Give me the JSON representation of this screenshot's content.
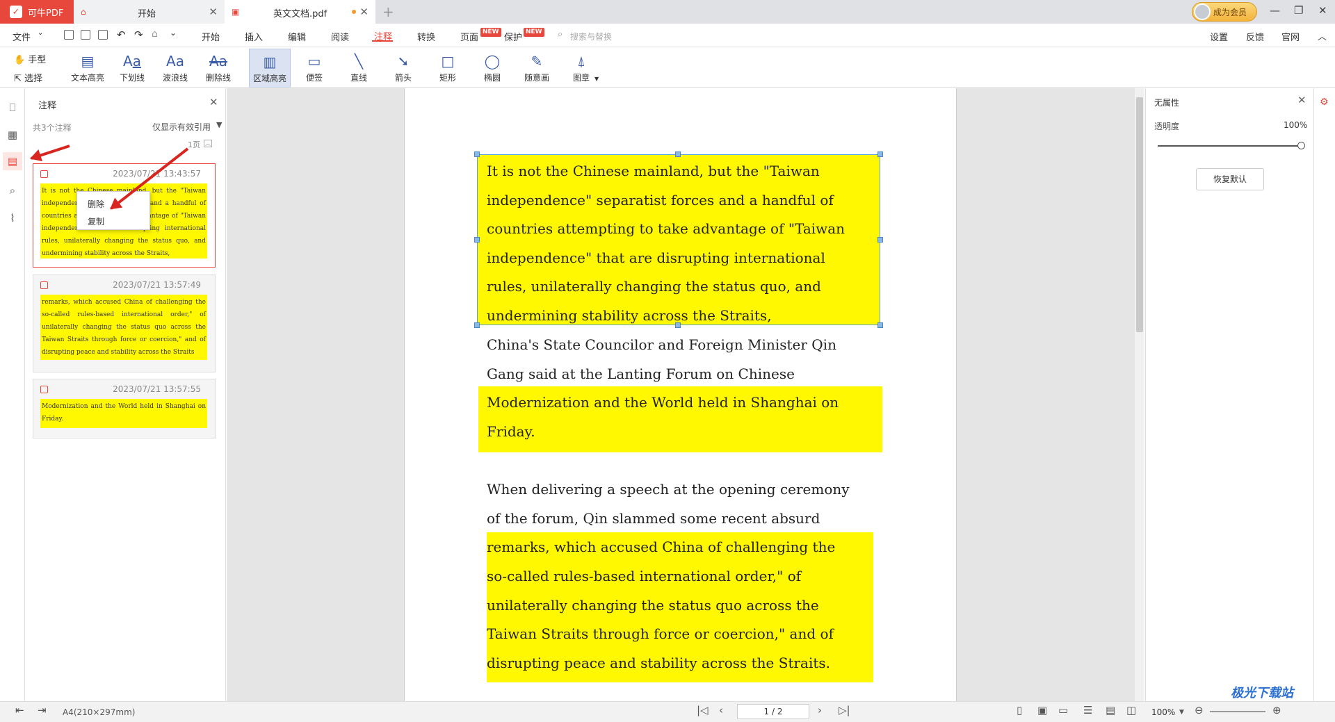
{
  "app": {
    "name": "可牛PDF"
  },
  "tabs": [
    {
      "label": "开始"
    },
    {
      "label": "英文文档.pdf"
    }
  ],
  "vip": {
    "label": "成为会员"
  },
  "menu": {
    "file": "文件",
    "items": [
      "开始",
      "插入",
      "编辑",
      "阅读",
      "注释",
      "转换",
      "页面",
      "保护"
    ],
    "active": "注释",
    "new_badge": "NEW",
    "search_placeholder": "搜索与替换",
    "right": [
      "设置",
      "反馈",
      "官网"
    ]
  },
  "toolbar": {
    "hand": "手型",
    "select": "选择",
    "tools": [
      "文本高亮",
      "下划线",
      "波浪线",
      "删除线",
      "区域高亮",
      "便签",
      "直线",
      "箭头",
      "矩形",
      "椭圆",
      "随意画",
      "图章"
    ],
    "selected": "区域高亮"
  },
  "annotations_panel": {
    "title": "注释",
    "count": "共3个注释",
    "filter_label": "仅显示有效引用",
    "page_group": "1页",
    "items": [
      {
        "time": "2023/07/21 13:43:57",
        "text": "It is not the Chinese mainland, but the \"Taiwan independence\" separatist forces and a handful of countries attempting to take advantage of \"Taiwan independence\" that are disrupting international rules, unilaterally changing the status quo, and undermining stability across the Straits,"
      },
      {
        "time": "2023/07/21 13:57:49",
        "text": "remarks, which accused China of challenging the so-called rules-based international order,\" of unilaterally changing the status quo across the Taiwan Straits through force or coercion,\" and of disrupting peace and stability across the Straits"
      },
      {
        "time": "2023/07/21 13:57:55",
        "text": "Modernization and the World held in Shanghai on Friday."
      }
    ],
    "context_menu": [
      "删除",
      "复制"
    ]
  },
  "document": {
    "lines": [
      "It is not the Chinese mainland, but the \"Taiwan",
      "independence\" separatist forces and a handful of",
      "countries attempting to take advantage of \"Taiwan",
      "independence\" that are disrupting international",
      "rules, unilaterally changing the status quo, and",
      "undermining  stability  across  the  Straits,",
      "China's State Councilor and Foreign Minister Qin",
      "Gang  said  at  the  Lanting  Forum  on  Chinese",
      "Modernization and the World held in Shanghai on",
      "Friday.",
      "When delivering a speech at the opening ceremony",
      "of  the  forum,  Qin  slammed  some  recent  absurd",
      "remarks, which accused China of challenging the",
      "so-called rules-based international order,\" of",
      "unilaterally changing the status quo across the",
      "Taiwan Straits through force or coercion,\" and of",
      "disrupting peace and stability across the Straits."
    ],
    "highlight_color": "#fff800"
  },
  "properties": {
    "title": "无属性",
    "opacity_label": "透明度",
    "opacity_value": "100%",
    "reset_label": "恢复默认"
  },
  "status": {
    "paper": "A4(210×297mm)",
    "page": "1 / 2",
    "zoom": "100%"
  },
  "colors": {
    "accent": "#e8483b",
    "highlight": "#fff800"
  }
}
